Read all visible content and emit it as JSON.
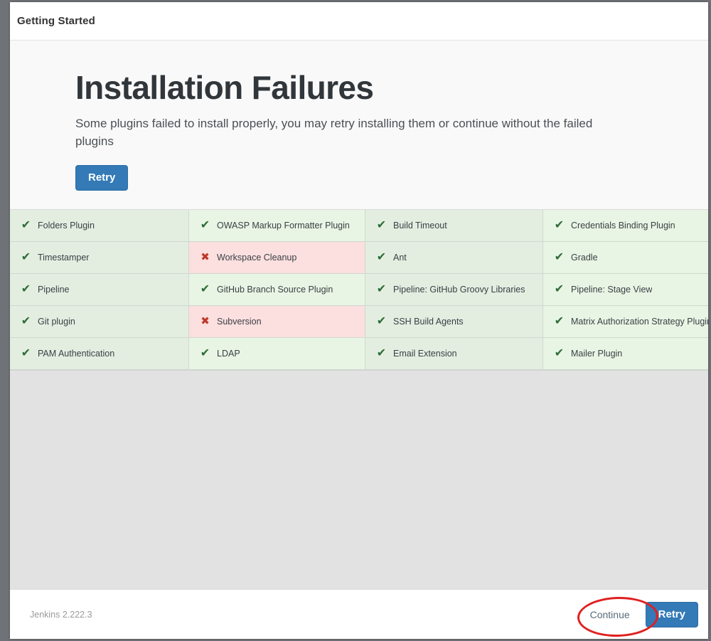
{
  "window": {
    "title": "Getting Started"
  },
  "hero": {
    "title": "Installation Failures",
    "subtitle": "Some plugins failed to install properly, you may retry installing them or continue without the failed plugins",
    "retry_label": "Retry"
  },
  "plugins": [
    {
      "name": "Folders Plugin",
      "status": "success",
      "icon": "check-icon"
    },
    {
      "name": "OWASP Markup Formatter Plugin",
      "status": "success",
      "icon": "check-icon"
    },
    {
      "name": "Build Timeout",
      "status": "success",
      "icon": "check-icon"
    },
    {
      "name": "Credentials Binding Plugin",
      "status": "success",
      "icon": "check-icon"
    },
    {
      "name": "Timestamper",
      "status": "success",
      "icon": "check-icon"
    },
    {
      "name": "Workspace Cleanup",
      "status": "failure",
      "icon": "cross-icon"
    },
    {
      "name": "Ant",
      "status": "success",
      "icon": "check-icon"
    },
    {
      "name": "Gradle",
      "status": "success",
      "icon": "check-icon"
    },
    {
      "name": "Pipeline",
      "status": "success",
      "icon": "check-icon"
    },
    {
      "name": "GitHub Branch Source Plugin",
      "status": "success",
      "icon": "check-icon"
    },
    {
      "name": "Pipeline: GitHub Groovy Libraries",
      "status": "success",
      "icon": "check-icon"
    },
    {
      "name": "Pipeline: Stage View",
      "status": "success",
      "icon": "check-icon"
    },
    {
      "name": "Git plugin",
      "status": "success",
      "icon": "check-icon"
    },
    {
      "name": "Subversion",
      "status": "failure",
      "icon": "cross-icon"
    },
    {
      "name": "SSH Build Agents",
      "status": "success",
      "icon": "check-icon"
    },
    {
      "name": "Matrix Authorization Strategy Plugin",
      "status": "success",
      "icon": "check-icon"
    },
    {
      "name": "PAM Authentication",
      "status": "success",
      "icon": "check-icon"
    },
    {
      "name": "LDAP",
      "status": "success",
      "icon": "check-icon"
    },
    {
      "name": "Email Extension",
      "status": "success",
      "icon": "check-icon"
    },
    {
      "name": "Mailer Plugin",
      "status": "success",
      "icon": "check-icon"
    }
  ],
  "footer": {
    "version": "Jenkins 2.222.3",
    "continue_label": "Continue",
    "retry_label": "Retry"
  },
  "icons": {
    "check": "✔",
    "cross": "✖"
  },
  "colors": {
    "primary_button": "#337ab7",
    "success_cell": "#e3eee1",
    "failure_cell": "#fbdcdc",
    "success_icon": "#2e6b34",
    "failure_icon": "#c0392b",
    "annotation": "#e02020",
    "page_background": "#e2e2e2"
  }
}
